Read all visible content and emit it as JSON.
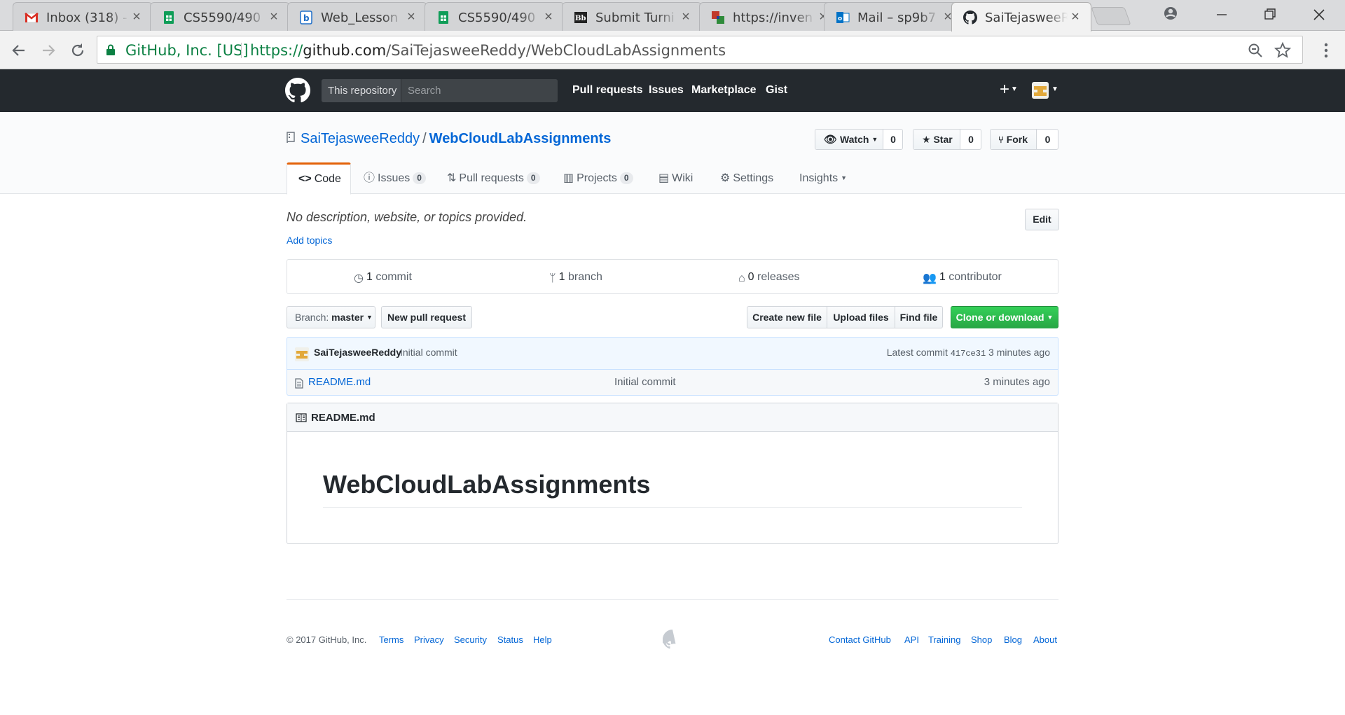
{
  "browser": {
    "tabs": [
      {
        "title": "Inbox (318) -",
        "icon": "gmail-icon"
      },
      {
        "title": "CS5590/490",
        "icon": "sheets-icon"
      },
      {
        "title": "Web_Lesson",
        "icon": "b-doc-icon"
      },
      {
        "title": "CS5590/490",
        "icon": "sheets-icon"
      },
      {
        "title": "Submit Turni",
        "icon": "blackboard-icon"
      },
      {
        "title": "https://inven",
        "icon": "app-icon"
      },
      {
        "title": "Mail – sp9b7",
        "icon": "outlook-icon"
      },
      {
        "title": "SaiTejasweeR",
        "icon": "github-icon",
        "active": true
      }
    ],
    "site_identity": "GitHub, Inc. [US]",
    "url_scheme": "https://",
    "url_host": "github.com",
    "url_path": "/SaiTejasweeReddy/WebCloudLabAssignments"
  },
  "header": {
    "scope_label": "This repository",
    "search_placeholder": "Search",
    "nav": [
      "Pull requests",
      "Issues",
      "Marketplace",
      "Gist"
    ],
    "plus_label": "+"
  },
  "repo": {
    "owner": "SaiTejasweeReddy",
    "separator": "/",
    "name": "WebCloudLabAssignments",
    "watch": {
      "label": "Watch",
      "count": "0"
    },
    "star": {
      "label": "Star",
      "count": "0"
    },
    "fork": {
      "label": "Fork",
      "count": "0"
    },
    "tabs": {
      "code": "Code",
      "issues": {
        "label": "Issues",
        "count": "0"
      },
      "pulls": {
        "label": "Pull requests",
        "count": "0"
      },
      "projects": {
        "label": "Projects",
        "count": "0"
      },
      "wiki": "Wiki",
      "settings": "Settings",
      "insights": "Insights"
    },
    "description": "No description, website, or topics provided.",
    "add_topics": "Add topics",
    "edit_label": "Edit",
    "summary": {
      "commits": {
        "count": "1",
        "label": "commit"
      },
      "branches": {
        "count": "1",
        "label": "branch"
      },
      "releases": {
        "count": "0",
        "label": "releases"
      },
      "contributors": {
        "count": "1",
        "label": "contributor"
      }
    },
    "branch_prefix": "Branch:",
    "branch_name": "master",
    "new_pr": "New pull request",
    "create_file": "Create new file",
    "upload_files": "Upload files",
    "find_file": "Find file",
    "clone": "Clone or download",
    "latest_commit": {
      "author": "SaiTejasweeReddy",
      "message": "Initial commit",
      "prefix": "Latest commit",
      "sha": "417ce31",
      "age": "3 minutes ago"
    },
    "files": [
      {
        "name": "README.md",
        "message": "Initial commit",
        "age": "3 minutes ago"
      }
    ],
    "readme": {
      "label": "README.md",
      "heading": "WebCloudLabAssignments"
    }
  },
  "footer": {
    "copyright": "© 2017 GitHub, Inc.",
    "left_links": [
      "Terms",
      "Privacy",
      "Security",
      "Status",
      "Help"
    ],
    "right_links": [
      "Contact GitHub",
      "API",
      "Training",
      "Shop",
      "Blog",
      "About"
    ]
  },
  "colors": {
    "header_bg": "#24292e",
    "link": "#0366d6",
    "clone_green": "#28a745",
    "active_tab_accent": "#e36209"
  }
}
